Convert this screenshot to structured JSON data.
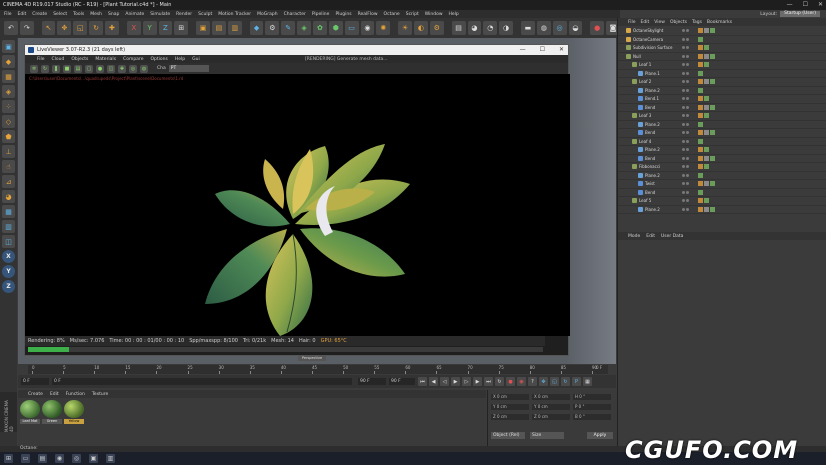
{
  "app": {
    "title": "CINEMA 4D R19.017 Studio (RC - R19) - [Plant Tutorial.c4d *] - Main",
    "window_controls": [
      "—",
      "☐",
      "✕"
    ],
    "layout_label": "Layout:",
    "layout_value": "Startup (User)"
  },
  "menubar": [
    "File",
    "Edit",
    "Create",
    "Select",
    "Tools",
    "Mesh",
    "Snap",
    "Animate",
    "Simulate",
    "Render",
    "Sculpt",
    "Motion Tracker",
    "MoGraph",
    "Character",
    "Pipeline",
    "Plugins",
    "RealFlow",
    "Octane",
    "Script",
    "Window",
    "Help"
  ],
  "render_window": {
    "title": "LiveViewer 3.07-R2.3 (21 days left)",
    "window_controls": [
      "—",
      "☐",
      "✕"
    ],
    "menu": [
      "File",
      "Cloud",
      "Objects",
      "Materials",
      "Compare",
      "Options",
      "Help",
      "Gui"
    ],
    "status_text": "[RENDERING]  Generate mesh data...",
    "zoom_label": "Cha",
    "zoom_value": "PT",
    "path_text": "C:\\Users\\user\\Documents\\...\\quadrupeds\\Project\\Plant\\scene\\Documents\\1.rd",
    "status_bar": {
      "rendering": "Rendering: 8%",
      "ms_sec": "Ms/sec: 7.076",
      "time": "Time: 00 : 00 : 01/00 : 00 : 10",
      "spp": "Spp/maxspp: 8/100",
      "tri": "Tri: 0/21k",
      "mesh": "Mesh: 14",
      "hair": "Hair: 0",
      "gpu": "GPU: 65°C"
    },
    "progress_fraction": 0.08
  },
  "viewport_label": "Perspective",
  "object_manager": {
    "menu": [
      "File",
      "Edit",
      "View",
      "Objects",
      "Tags",
      "Bookmarks"
    ],
    "rows": [
      {
        "name": "OctaneSkylight",
        "depth": 0
      },
      {
        "name": "OctaneCamera",
        "depth": 0
      },
      {
        "name": "Subdivision Surface",
        "depth": 0
      },
      {
        "name": "Null",
        "depth": 0
      },
      {
        "name": "Leaf 1",
        "depth": 1
      },
      {
        "name": "Plane.1",
        "depth": 2
      },
      {
        "name": "Leaf 2",
        "depth": 1
      },
      {
        "name": "Plane.2",
        "depth": 2
      },
      {
        "name": "Bend.1",
        "depth": 2
      },
      {
        "name": "Bend",
        "depth": 2
      },
      {
        "name": "Leaf 3",
        "depth": 1
      },
      {
        "name": "Plane.2",
        "depth": 2
      },
      {
        "name": "Bend",
        "depth": 2
      },
      {
        "name": "Leaf 4",
        "depth": 1
      },
      {
        "name": "Plane.2",
        "depth": 2
      },
      {
        "name": "Bend",
        "depth": 2
      },
      {
        "name": "Fibbonacci",
        "depth": 1
      },
      {
        "name": "Plane.2",
        "depth": 2
      },
      {
        "name": "Twist",
        "depth": 2
      },
      {
        "name": "Bend",
        "depth": 2
      },
      {
        "name": "Leaf 5",
        "depth": 1
      },
      {
        "name": "Plane.2",
        "depth": 2
      }
    ]
  },
  "attribute_manager": {
    "menu": [
      "Mode",
      "Edit",
      "User Data"
    ]
  },
  "timeline": {
    "ticks": [
      "0",
      "5",
      "10",
      "15",
      "20",
      "25",
      "30",
      "35",
      "40",
      "45",
      "50",
      "55",
      "60",
      "65",
      "70",
      "75",
      "80",
      "85",
      "90"
    ],
    "end_label": "0 F"
  },
  "transport": {
    "start_field": "0 F",
    "current_field": "0 F",
    "end_field": "90 F",
    "max_field": "90 F"
  },
  "material_manager": {
    "menu": [
      "Create",
      "Edit",
      "Function",
      "Texture"
    ],
    "materials": [
      {
        "label": "Leaf Mat",
        "selected": false
      },
      {
        "label": "Green",
        "selected": false
      },
      {
        "label": "Yellow",
        "selected": true
      }
    ]
  },
  "coordinates": {
    "rows": [
      [
        "X  0 cm",
        "X  0 cm",
        "H  0 °"
      ],
      [
        "Y  0 cm",
        "Y  0 cm",
        "P  0 °"
      ],
      [
        "Z  0 cm",
        "Z  0 cm",
        "B  0 °"
      ]
    ],
    "dropdown_1": "Object (Rel)",
    "dropdown_2": "Size",
    "apply_label": "Apply"
  },
  "sidebar_tag": "MAXON CINEMA 4D",
  "statusbar_text": "Octane:",
  "watermark": "CGUFO.COM",
  "colors": {
    "accent": "#e4a23a",
    "progress": "#3db04a",
    "error_path": "#9a3a3a"
  }
}
